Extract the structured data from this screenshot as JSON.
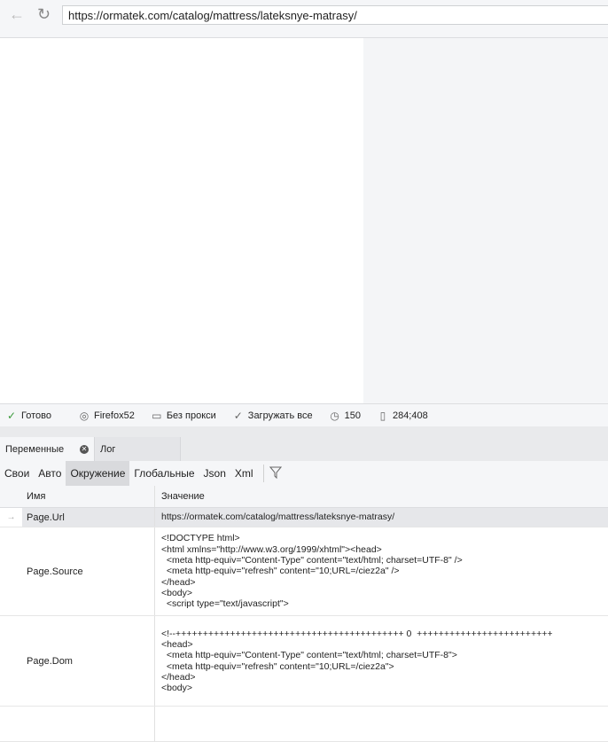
{
  "browser": {
    "back_icon": "arrow-left-icon",
    "reload_icon": "reload-icon",
    "url": "https://ormatek.com/catalog/mattress/lateksnye-matrasy/"
  },
  "status": {
    "ready": "Готово",
    "browser": "Firefox52",
    "proxy": "Без прокси",
    "load": "Загружать все",
    "timeout": "150",
    "coords": "284;408"
  },
  "tabs": [
    {
      "label": "Переменные"
    },
    {
      "label": "Лог"
    }
  ],
  "subtabs": [
    "Свои",
    "Авто",
    "Окружение",
    "Глобальные",
    "Json",
    "Xml"
  ],
  "table": {
    "headers": [
      "Имя",
      "Значение"
    ],
    "rows": [
      {
        "name": "Page.Url",
        "lines": [
          "https://ormatek.com/catalog/mattress/lateksnye-matrasy/"
        ]
      },
      {
        "name": "Page.Source",
        "lines": [
          "<!DOCTYPE html>",
          "<html xmlns=\"http://www.w3.org/1999/xhtml\"><head>",
          "  <meta http-equiv=\"Content-Type\" content=\"text/html; charset=UTF-8\" />",
          "  <meta http-equiv=\"refresh\" content=\"10;URL=/ciez2a\" />",
          "</head>",
          "<body>",
          "  <script type=\"text/javascript\">"
        ]
      },
      {
        "name": "Page.Dom",
        "lines": [
          "<!--++++++++++++++++++++++++++++++++++++++++++ 0  +++++++++++++++++++++++++",
          "<head>",
          "  <meta http-equiv=\"Content-Type\" content=\"text/html; charset=UTF-8\">",
          "  <meta http-equiv=\"refresh\" content=\"10;URL=/ciez2a\">",
          "</head>",
          "<body>"
        ]
      }
    ]
  }
}
